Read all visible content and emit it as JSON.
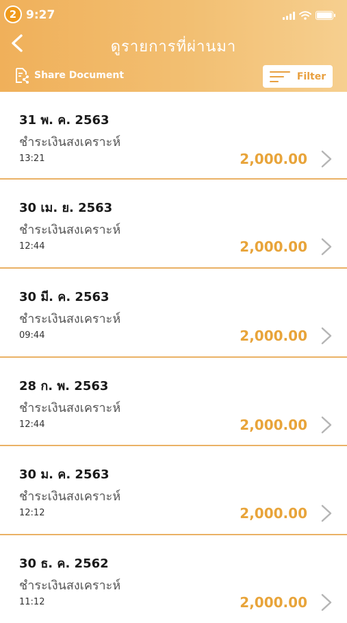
{
  "status_bar": {
    "notification_count": "2",
    "time": "9:27"
  },
  "header": {
    "title": "ดูรายการที่ผ่านมา",
    "share_label": "Share Document",
    "filter_label": "Filter"
  },
  "transactions": [
    {
      "date": "31 พ. ค. 2563",
      "desc": "ชำระเงินสงเคราะห์",
      "time": "13:21",
      "amount": "2,000.00"
    },
    {
      "date": "30 เม. ย. 2563",
      "desc": "ชำระเงินสงเคราะห์",
      "time": "12:44",
      "amount": "2,000.00"
    },
    {
      "date": "30 มี. ค. 2563",
      "desc": "ชำระเงินสงเคราะห์",
      "time": "09:44",
      "amount": "2,000.00"
    },
    {
      "date": "28 ก. พ. 2563",
      "desc": "ชำระเงินสงเคราะห์",
      "time": "12:44",
      "amount": "2,000.00"
    },
    {
      "date": "30 ม. ค. 2563",
      "desc": "ชำระเงินสงเคราะห์",
      "time": "12:12",
      "amount": "2,000.00"
    },
    {
      "date": "30 ธ. ค. 2562",
      "desc": "ชำระเงินสงเคราะห์",
      "time": "11:12",
      "amount": "2,000.00"
    }
  ],
  "icons": [
    "back-arrow-icon",
    "share-document-icon",
    "filter-lines-icon",
    "chevron-right-icon",
    "signal-icon",
    "wifi-icon",
    "battery-icon"
  ],
  "colors": {
    "accent": "#e8a43a",
    "header_start": "#f0b05a",
    "header_end": "#f6cf8f",
    "divider": "#eab165"
  }
}
